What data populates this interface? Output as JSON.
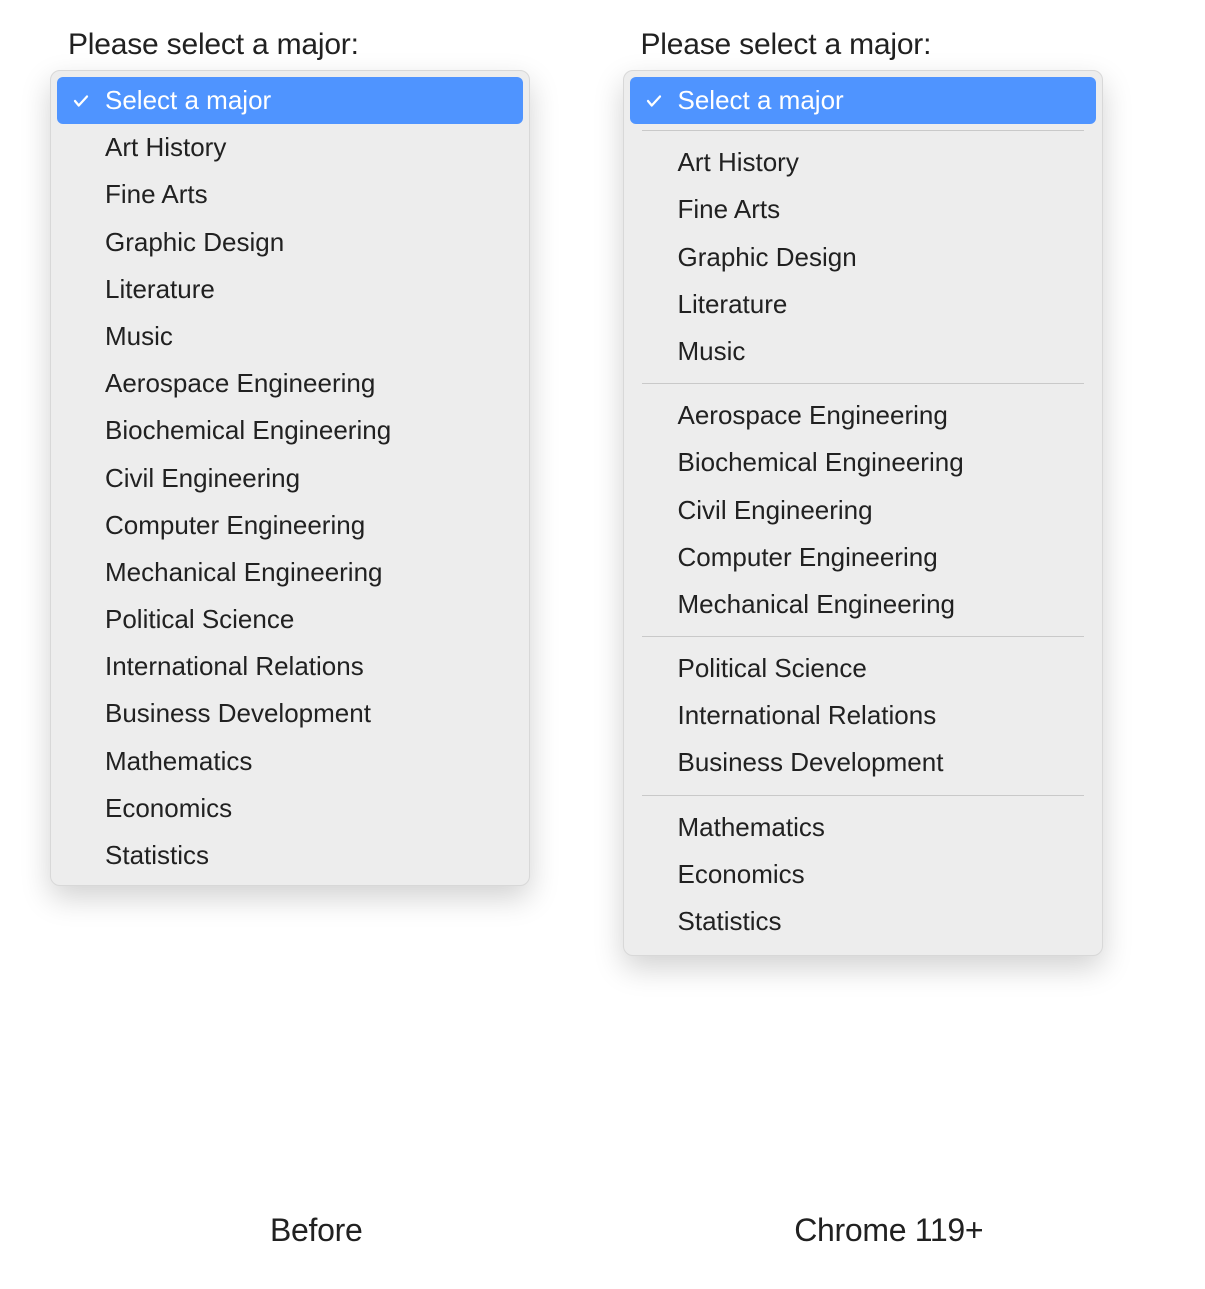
{
  "prompt_label": "Please select a major:",
  "selected_label": "Select a major",
  "captions": {
    "left": "Before",
    "right": "Chrome 119+"
  },
  "left": {
    "options": [
      "Art History",
      "Fine Arts",
      "Graphic Design",
      "Literature",
      "Music",
      "Aerospace Engineering",
      "Biochemical Engineering",
      "Civil Engineering",
      "Computer Engineering",
      "Mechanical Engineering",
      "Political Science",
      "International Relations",
      "Business Development",
      "Mathematics",
      "Economics",
      "Statistics"
    ]
  },
  "right": {
    "groups": [
      [
        "Art History",
        "Fine Arts",
        "Graphic Design",
        "Literature",
        "Music"
      ],
      [
        "Aerospace Engineering",
        "Biochemical Engineering",
        "Civil Engineering",
        "Computer Engineering",
        "Mechanical Engineering"
      ],
      [
        "Political Science",
        "International Relations",
        "Business Development"
      ],
      [
        "Mathematics",
        "Economics",
        "Statistics"
      ]
    ]
  }
}
